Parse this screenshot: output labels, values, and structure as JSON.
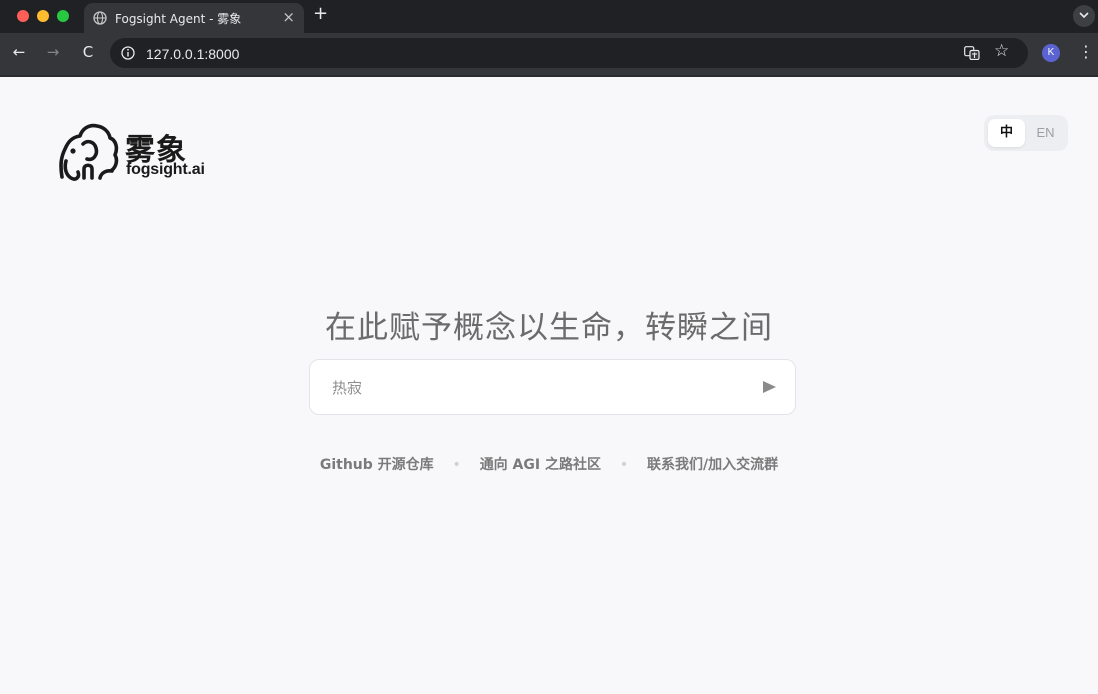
{
  "browser": {
    "tab_title": "Fogsight Agent - 雾象",
    "tab_close": "×",
    "new_tab": "+",
    "url": "127.0.0.1:8000",
    "nav_back": "←",
    "nav_forward": "→",
    "nav_reload": "C",
    "star": "☆",
    "avatar_letter": "K",
    "menu": "⋮"
  },
  "logo": {
    "name_cn": "雾象",
    "name_en": "fogsight.ai"
  },
  "language": {
    "zh": "中",
    "en": "EN",
    "active": "zh"
  },
  "hero": {
    "headline": "在此赋予概念以生命，转瞬之间"
  },
  "search": {
    "placeholder": "热寂",
    "value": ""
  },
  "links": [
    "Github 开源仓库",
    "通向 AGI 之路社区",
    "联系我们/加入交流群"
  ],
  "colors": {
    "page_bg": "#f8f8fa",
    "chrome_dark": "#202124",
    "chrome_toolbar": "#35363a",
    "headline": "#6b6b6b",
    "link": "#7a7a7a"
  }
}
